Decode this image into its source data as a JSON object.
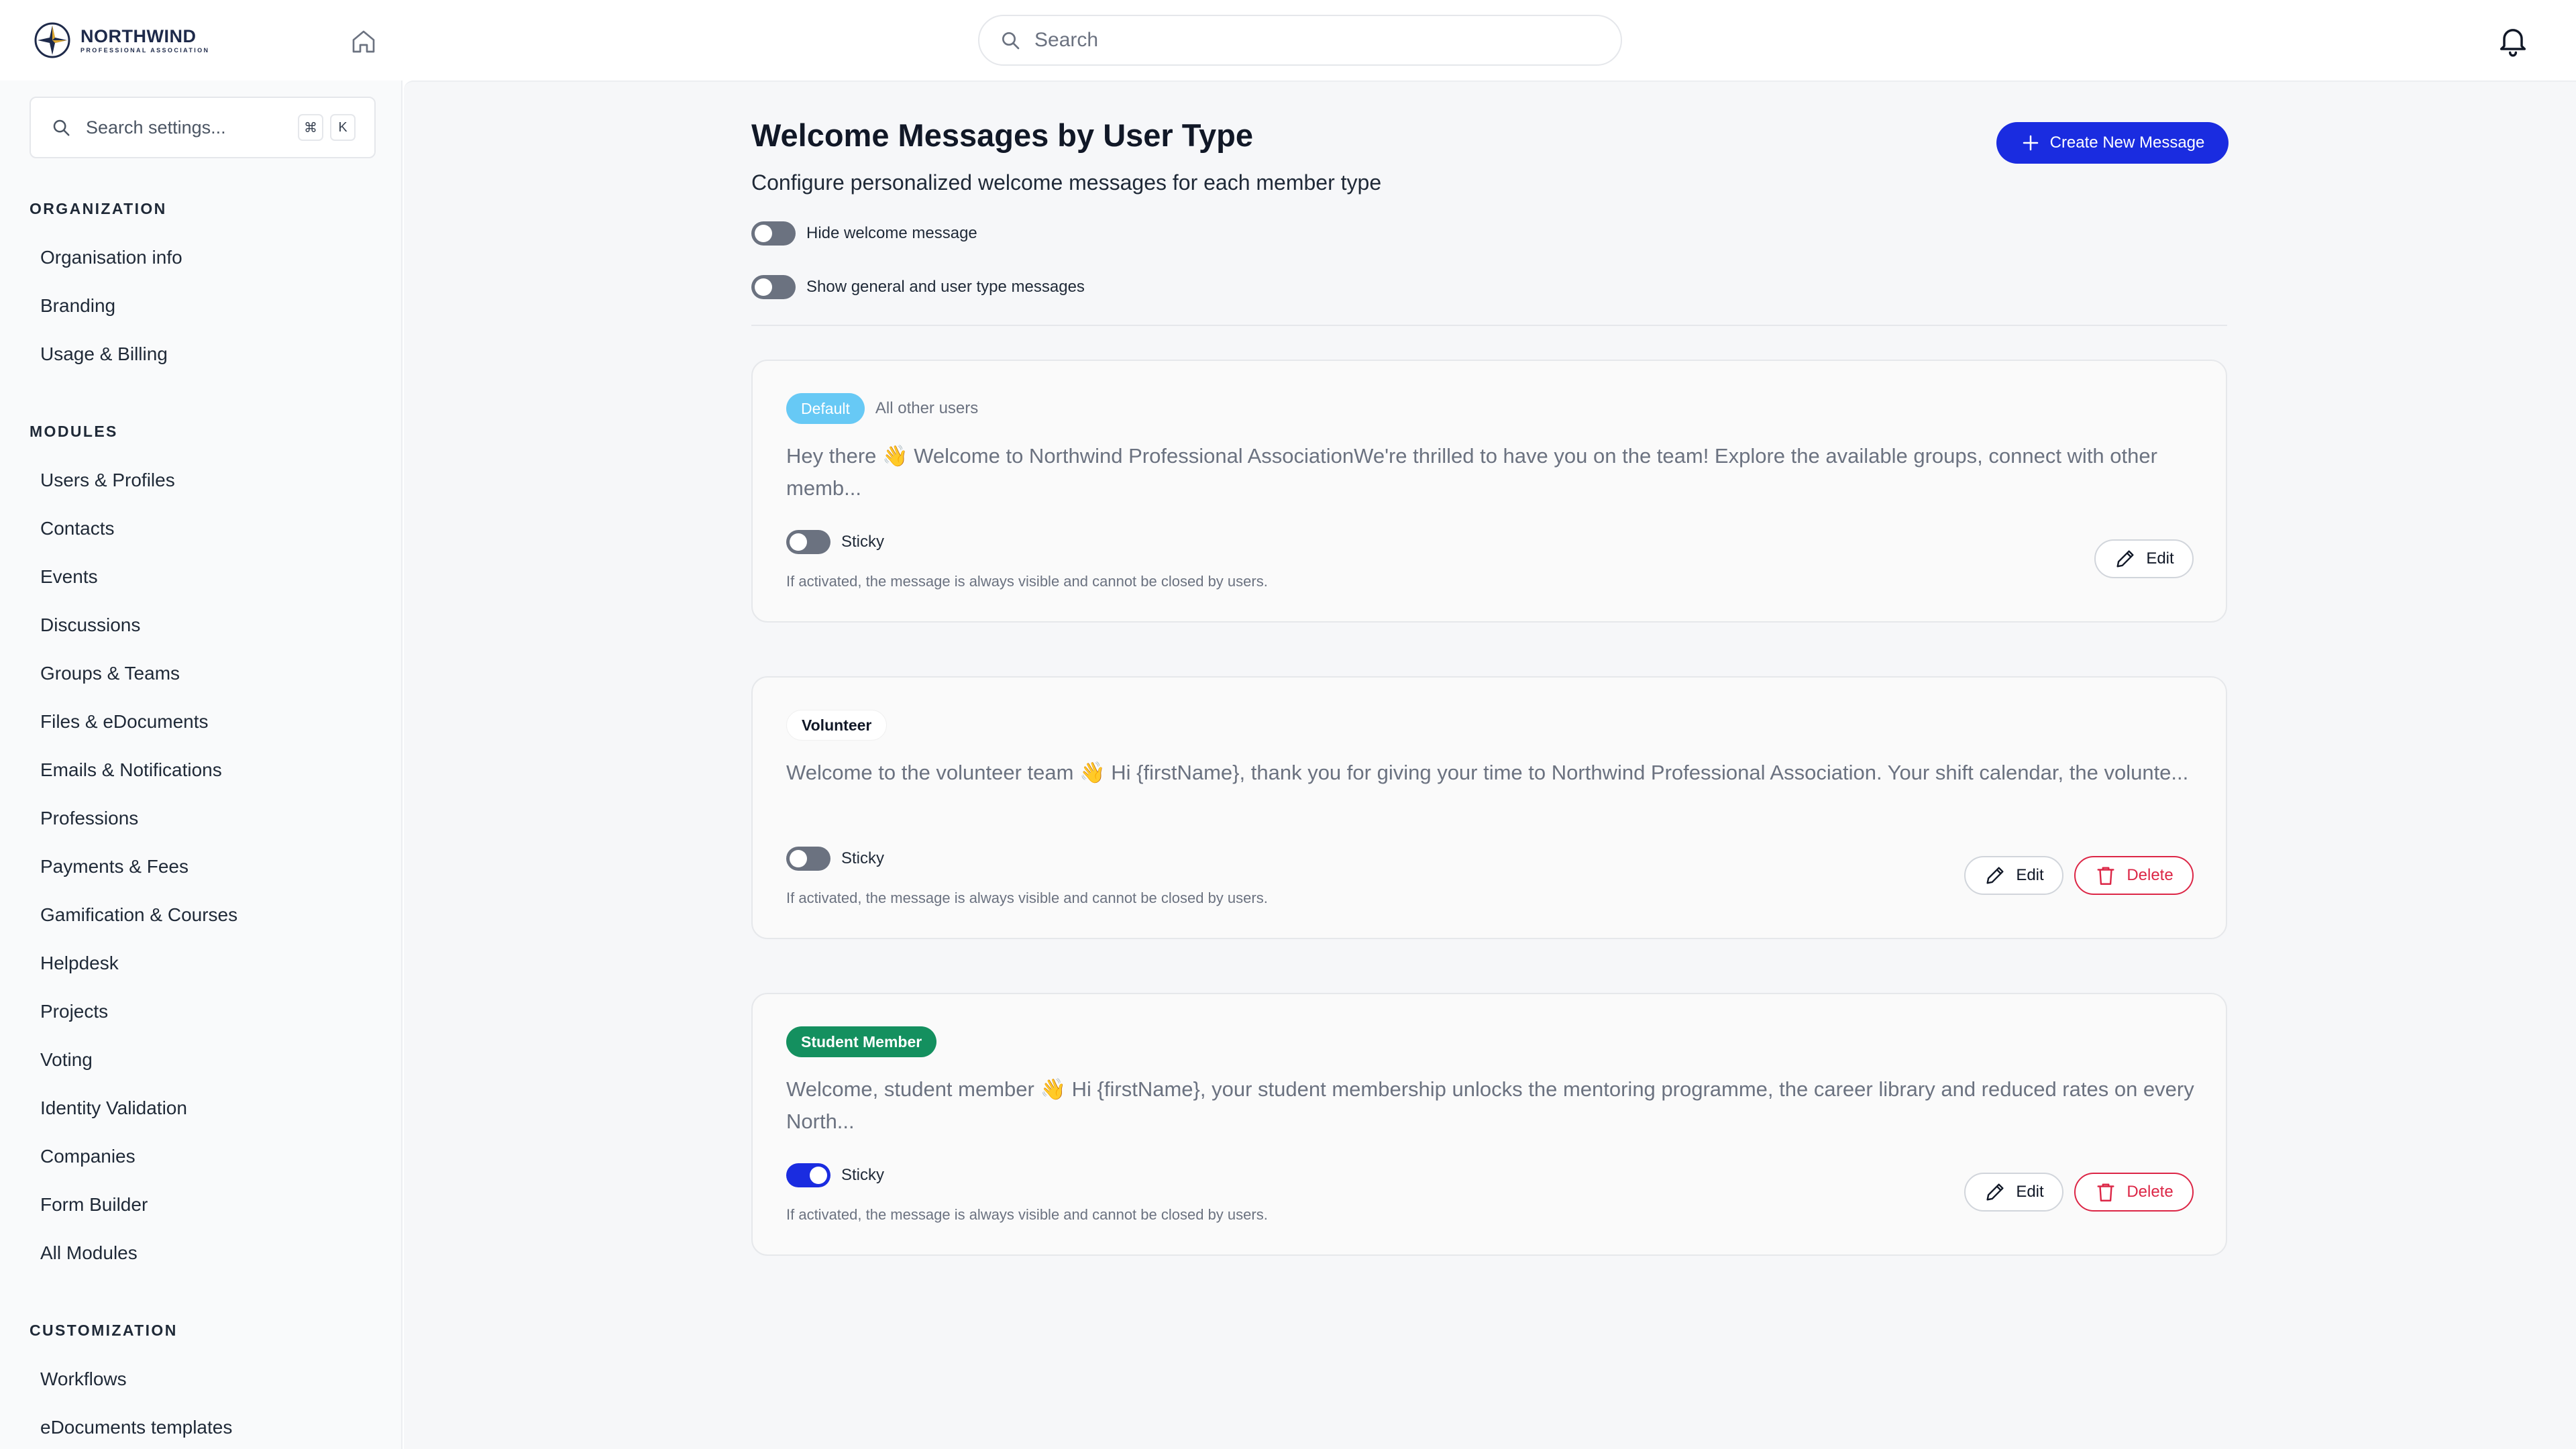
{
  "app": {
    "logo_name": "NORTHWIND",
    "logo_sub": "PROFESSIONAL ASSOCIATION",
    "search_placeholder": "Search"
  },
  "sidebar": {
    "search_placeholder": "Search settings...",
    "shortcut_keys": [
      "⌘",
      "K"
    ],
    "sections": [
      {
        "title": "ORGANIZATION",
        "items": [
          "Organisation info",
          "Branding",
          "Usage & Billing"
        ]
      },
      {
        "title": "MODULES",
        "items": [
          "Users & Profiles",
          "Contacts",
          "Events",
          "Discussions",
          "Groups & Teams",
          "Files & eDocuments",
          "Emails & Notifications",
          "Professions",
          "Payments & Fees",
          "Gamification & Courses",
          "Helpdesk",
          "Projects",
          "Voting",
          "Identity Validation",
          "Companies",
          "Form Builder",
          "All Modules"
        ]
      },
      {
        "title": "CUSTOMIZATION",
        "items": [
          "Workflows",
          "eDocuments templates"
        ]
      }
    ]
  },
  "main": {
    "title": "Welcome Messages by User Type",
    "subtitle": "Configure personalized welcome messages for each member type",
    "create_button": "Create New Message",
    "toggles": [
      {
        "label": "Hide welcome message",
        "on": false
      },
      {
        "label": "Show general and user type messages",
        "on": false
      }
    ],
    "cards": [
      {
        "badge": "Default",
        "badge_style": "default",
        "badge_desc": "All other users",
        "message": "Hey there 👋 Welcome to Northwind Professional AssociationWe're thrilled to have you on the team! Explore the available groups, connect with other memb...",
        "sticky_label": "Sticky",
        "sticky_on": false,
        "help": "If activated, the message is always visible and cannot be closed by users.",
        "edit_label": "Edit",
        "delete_label": null
      },
      {
        "badge": "Volunteer",
        "badge_style": "volunteer",
        "badge_desc": "",
        "message": "Welcome to the volunteer team 👋 Hi {firstName}, thank you for giving your time to Northwind Professional Association. Your shift calendar, the volunte...",
        "sticky_label": "Sticky",
        "sticky_on": false,
        "help": "If activated, the message is always visible and cannot be closed by users.",
        "edit_label": "Edit",
        "delete_label": "Delete"
      },
      {
        "badge": "Student Member",
        "badge_style": "student",
        "badge_desc": "",
        "message": "Welcome, student member 👋 Hi {firstName}, your student membership unlocks the mentoring programme, the career library and reduced rates on every North...",
        "sticky_label": "Sticky",
        "sticky_on": true,
        "help": "If activated, the message is always visible and cannot be closed by users.",
        "edit_label": "Edit",
        "delete_label": "Delete"
      }
    ]
  },
  "colors": {
    "accent": "#1a2ce0",
    "danger": "#dc2646",
    "default_badge": "#67c9f5",
    "student_badge": "#14905f"
  },
  "icons": [
    "compass-logo-icon",
    "home-icon",
    "search-icon",
    "bell-icon",
    "plus-icon",
    "pencil-icon",
    "trash-icon"
  ]
}
